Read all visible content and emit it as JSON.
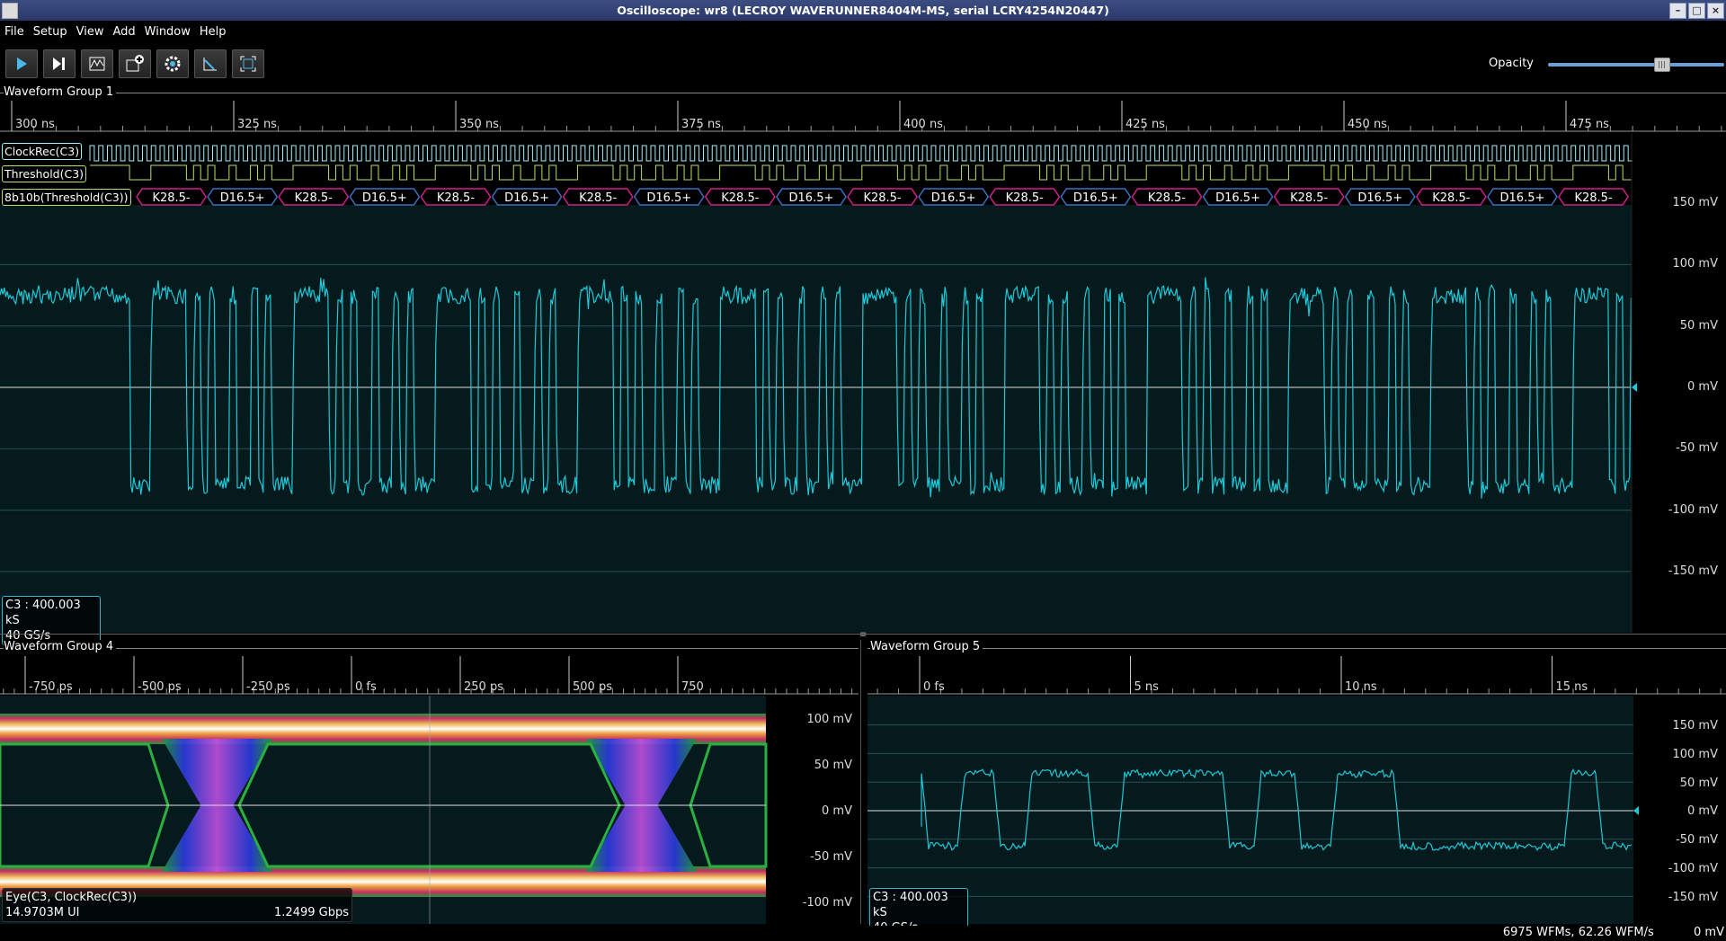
{
  "window": {
    "title": "Oscilloscope: wr8 (LECROY WAVERUNNER8404M-MS, serial LCRY4254N20447)"
  },
  "menu": [
    "File",
    "Setup",
    "View",
    "Add",
    "Window",
    "Help"
  ],
  "toolbar": {
    "buttons": [
      "start-trigger",
      "single-trigger",
      "waveform",
      "add-measurement",
      "settings",
      "cursor",
      "fullscreen"
    ],
    "opacity_label": "Opacity",
    "opacity_value": 0.78
  },
  "groups": {
    "g1": {
      "title": "Waveform Group 1",
      "time_ticks": [
        "300 ns",
        "325 ns",
        "350 ns",
        "375 ns",
        "400 ns",
        "425 ns",
        "450 ns",
        "475 ns"
      ],
      "volt_ticks": [
        "150 mV",
        "100 mV",
        "50 mV",
        "0 mV",
        "-50 mV",
        "-100 mV",
        "-150 mV"
      ],
      "protocol_rows": [
        "ClockRec(C3)",
        "Threshold(C3)",
        "8b10b(Threshold(C3))"
      ],
      "symbols": [
        "K28.5-",
        "D16.5+",
        "K28.5-",
        "D16.5+",
        "K28.5-",
        "D16.5+",
        "K28.5-",
        "D16.5+",
        "K28.5-",
        "D16.5+",
        "K28.5-",
        "D16.5+",
        "K28.5-",
        "D16.5+",
        "K28.5-",
        "D16.5+",
        "K28.5-",
        "D16.5+",
        "K28.5-",
        "D16.5+",
        "K28.5-"
      ],
      "info_line1": "C3 : 400.003 kS",
      "info_line2": "40 GS/s"
    },
    "g4": {
      "title": "Waveform Group 4",
      "time_ticks": [
        "-750 ps",
        "-500 ps",
        "-250 ps",
        "0 fs",
        "250 ps",
        "500 ps",
        "750"
      ],
      "volt_ticks": [
        "100 mV",
        "50 mV",
        "0 mV",
        "-50 mV",
        "-100 mV"
      ],
      "info_line1": "Eye(C3, ClockRec(C3))",
      "info_line2a": "14.9703M UI",
      "info_line2b": "1.2499 Gbps"
    },
    "g5": {
      "title": "Waveform Group 5",
      "time_ticks": [
        "0 fs",
        "5 ns",
        "10 ns",
        "15 ns"
      ],
      "volt_ticks": [
        "150 mV",
        "100 mV",
        "50 mV",
        "0 mV",
        "-50 mV",
        "-100 mV",
        "-150 mV"
      ],
      "info_line1": "C3 : 400.003 kS",
      "info_line2": "40 GS/s"
    }
  },
  "status": {
    "wfms": "6975 WFMs, 62.26 WFM/s",
    "value": "0 mV"
  },
  "colors": {
    "trace": "#1ec8d8",
    "clock": "#9ff0f8",
    "threshold": "#b8e06a",
    "k_symbol": "#d0208a",
    "d_symbol": "#3a70c0",
    "plot_bg": "#051a1c"
  }
}
